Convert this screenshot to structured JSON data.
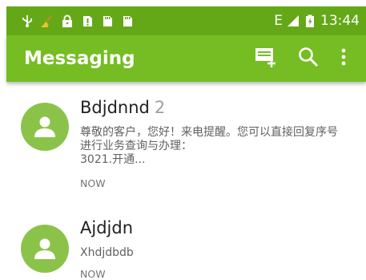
{
  "status_bar": {
    "icons_left": [
      "usb-icon",
      "cleaner-icon",
      "lock-icon",
      "sim-alert-icon",
      "sd-card-icon",
      "sd-card-icon"
    ],
    "network_label": "E",
    "time": "13:44",
    "colors": {
      "bg": "#64a818"
    }
  },
  "app_bar": {
    "title": "Messaging",
    "actions": [
      "new-message-icon",
      "search-icon",
      "overflow-menu-icon"
    ],
    "colors": {
      "bg": "#75bd22"
    }
  },
  "conversations": [
    {
      "name": "Bdjdnnd",
      "count": "2",
      "snippet_line1": "尊敬的客户，您好！来电提醒。您可以直接回复序号",
      "snippet_line2": "进行业务查询与办理：",
      "snippet_line3": "3021.开通...",
      "time": "NOW"
    },
    {
      "name": "Ajdjdn",
      "count": "",
      "snippet_line1": "Xhdjdbdb",
      "time": "NOW"
    }
  ]
}
